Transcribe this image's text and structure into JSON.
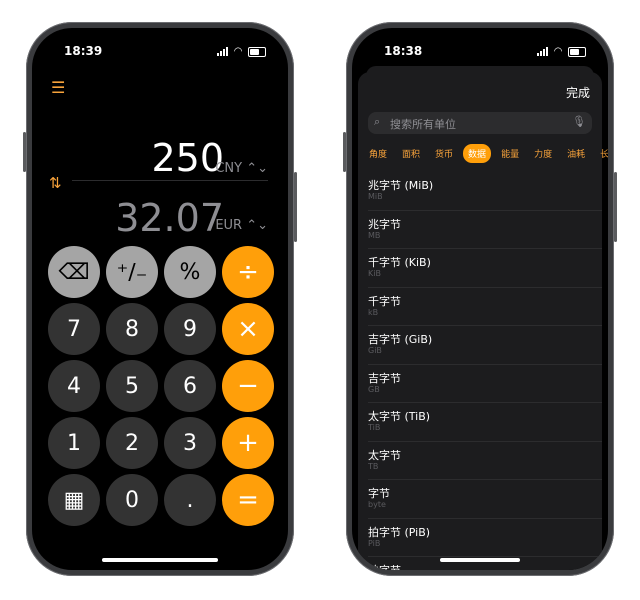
{
  "left_phone": {
    "status": {
      "time": "18:39"
    },
    "top_amount": "250",
    "top_currency": "CNY ⌃⌄",
    "bottom_amount": "32.07",
    "bottom_currency": "EUR ⌃⌄",
    "keys": [
      {
        "label": "⌫",
        "kind": "fn",
        "name": "backspace-key"
      },
      {
        "label": "⁺∕₋",
        "kind": "fn",
        "name": "plus-minus-key"
      },
      {
        "label": "%",
        "kind": "fn",
        "name": "percent-key"
      },
      {
        "label": "÷",
        "kind": "op",
        "name": "divide-key"
      },
      {
        "label": "7",
        "kind": "num",
        "name": "seven-key"
      },
      {
        "label": "8",
        "kind": "num",
        "name": "eight-key"
      },
      {
        "label": "9",
        "kind": "num",
        "name": "nine-key"
      },
      {
        "label": "×",
        "kind": "op",
        "name": "multiply-key"
      },
      {
        "label": "4",
        "kind": "num",
        "name": "four-key"
      },
      {
        "label": "5",
        "kind": "num",
        "name": "five-key"
      },
      {
        "label": "6",
        "kind": "num",
        "name": "six-key"
      },
      {
        "label": "−",
        "kind": "op",
        "name": "minus-key"
      },
      {
        "label": "1",
        "kind": "num",
        "name": "one-key"
      },
      {
        "label": "2",
        "kind": "num",
        "name": "two-key"
      },
      {
        "label": "3",
        "kind": "num",
        "name": "three-key"
      },
      {
        "label": "+",
        "kind": "op",
        "name": "plus-key"
      },
      {
        "label": "▦",
        "kind": "num",
        "name": "calculator-mode-key"
      },
      {
        "label": "0",
        "kind": "num",
        "name": "zero-key"
      },
      {
        "label": ".",
        "kind": "num",
        "name": "decimal-key"
      },
      {
        "label": "=",
        "kind": "op",
        "name": "equals-key"
      }
    ]
  },
  "right_phone": {
    "status": {
      "time": "18:38"
    },
    "done_label": "完成",
    "search_placeholder": "搜索所有单位",
    "categories": [
      "角度",
      "面积",
      "货币",
      "数据",
      "能量",
      "力度",
      "油耗",
      "长度"
    ],
    "active_category": "数据",
    "units": [
      {
        "title": "兆字节 (MiB)",
        "sub": "MiB"
      },
      {
        "title": "兆字节",
        "sub": "MB"
      },
      {
        "title": "千字节 (KiB)",
        "sub": "KiB"
      },
      {
        "title": "千字节",
        "sub": "kB"
      },
      {
        "title": "吉字节 (GiB)",
        "sub": "GiB"
      },
      {
        "title": "吉字节",
        "sub": "GB"
      },
      {
        "title": "太字节 (TiB)",
        "sub": "TiB"
      },
      {
        "title": "太字节",
        "sub": "TB"
      },
      {
        "title": "字节",
        "sub": "byte"
      },
      {
        "title": "拍字节 (PiB)",
        "sub": "PiB"
      },
      {
        "title": "拍字节",
        "sub": ""
      }
    ]
  },
  "colors": {
    "accent": "#ff9f0a",
    "key_dark": "#333333",
    "key_light": "#a5a5a5"
  }
}
